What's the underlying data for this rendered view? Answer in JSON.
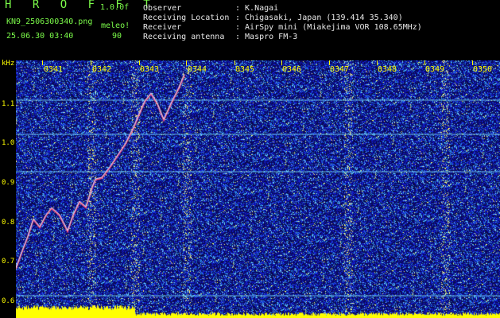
{
  "app": {
    "brand": "H R O F F T",
    "version": "1.0.0f",
    "filename": "KN9_2506300340.png",
    "datetime": "25.06.30 03:40",
    "site_tag": "meleo!",
    "gain": "90"
  },
  "info": [
    {
      "label": "Observer",
      "value": ": K.Nagai"
    },
    {
      "label": "Receiving Location",
      "value": ": Chigasaki, Japan (139.414 35.340)"
    },
    {
      "label": "Receiver",
      "value": ": AirSpy mini (Miakejima VOR 108.65MHz)"
    },
    {
      "label": "Receiving antenna",
      "value": ": Maspro FM-3"
    }
  ],
  "axis": {
    "unit": "kHz",
    "y_ticks": [
      "1.1",
      "1.0",
      "0.9",
      "0.8",
      "0.7",
      "0.6"
    ],
    "time_ticks": [
      "0341",
      "0342",
      "0343",
      "0344",
      "0345",
      "0346",
      "0347",
      "0348",
      "0349",
      "0350"
    ]
  },
  "colors": {
    "background": "#000000",
    "label_green": "#7CFC4A",
    "tick_yellow": "#ffff00",
    "noise_blue": "#1a1a8c",
    "carrier_cyan": "#7ee0ff",
    "meteor_trace": "#ff4b7a",
    "activity_bar": "#ffff00"
  }
}
